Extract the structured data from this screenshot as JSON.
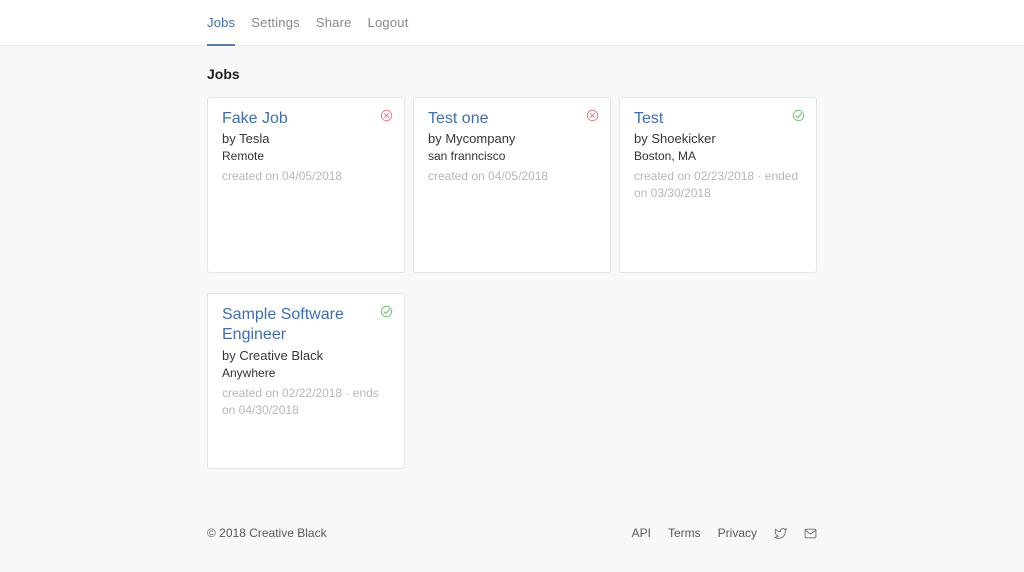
{
  "nav": {
    "items": [
      {
        "label": "Jobs",
        "active": true
      },
      {
        "label": "Settings",
        "active": false
      },
      {
        "label": "Share",
        "active": false
      },
      {
        "label": "Logout",
        "active": false
      }
    ]
  },
  "page": {
    "heading": "Jobs"
  },
  "jobs": [
    {
      "title": "Fake Job",
      "company": "by Tesla",
      "location": "Remote",
      "meta": "created on 04/05/2018",
      "status": "closed"
    },
    {
      "title": "Test one",
      "company": "by Mycompany",
      "location": "san franncisco",
      "meta": "created on 04/05/2018",
      "status": "closed"
    },
    {
      "title": "Test",
      "company": "by Shoekicker",
      "location": "Boston, MA",
      "meta": "created on 02/23/2018 · ended on 03/30/2018",
      "status": "active"
    },
    {
      "title": "Sample Software Engineer",
      "company": "by Creative Black",
      "location": "Anywhere",
      "meta": "created on 02/22/2018 · ends on 04/30/2018",
      "status": "active"
    }
  ],
  "footer": {
    "copyright": "© 2018 Creative Black",
    "links": [
      "API",
      "Terms",
      "Privacy"
    ],
    "icons": [
      "twitter-icon",
      "email-icon"
    ]
  },
  "colors": {
    "accent_blue": "#3e6db5",
    "nav_underline": "#5b7ca8",
    "closed_red": "#e8808b",
    "active_green": "#72bf77",
    "muted_text": "#b4b7ba",
    "page_background": "#f7f8f9"
  }
}
